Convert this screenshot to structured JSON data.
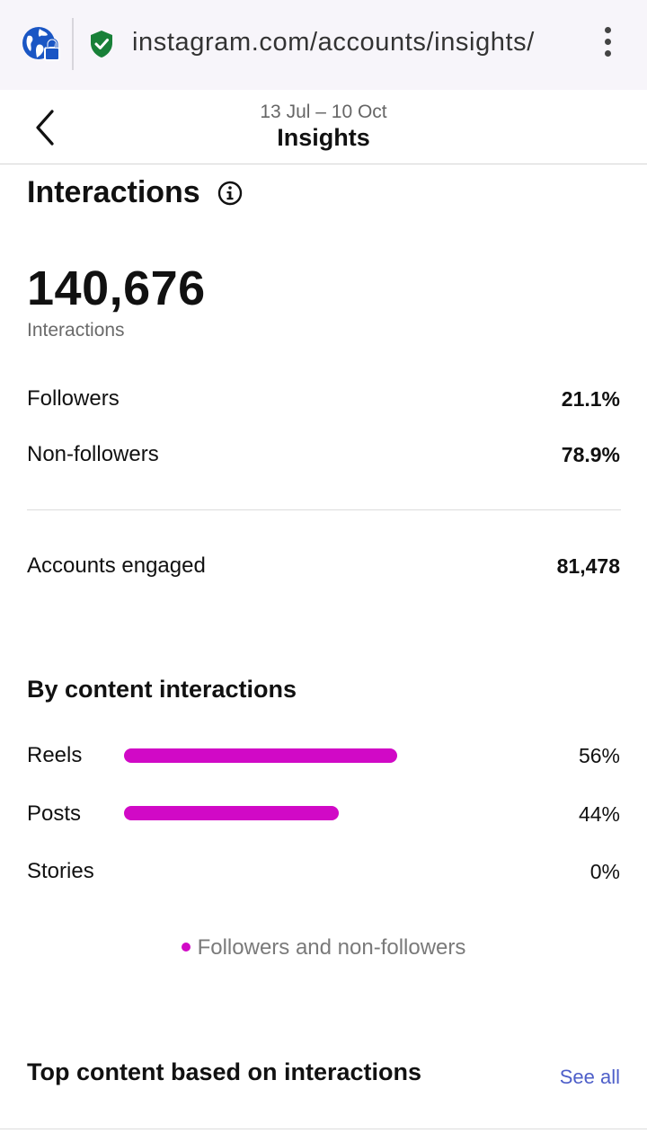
{
  "browser": {
    "url": "instagram.com/accounts/insights/",
    "icons": {
      "site": "globe-lock-icon",
      "secure": "shield-check-icon",
      "menu": "kebab-menu-icon"
    },
    "colors": {
      "secure": "#188038",
      "site": "#1a56c4"
    }
  },
  "header": {
    "date_range": "13 Jul – 10 Oct",
    "title": "Insights",
    "back_icon": "chevron-left-icon"
  },
  "interactions": {
    "title": "Interactions",
    "info_icon": "info-icon",
    "total": "140,676",
    "total_label": "Interactions",
    "breakdown": [
      {
        "label": "Followers",
        "value": "21.1%"
      },
      {
        "label": "Non-followers",
        "value": "78.9%"
      }
    ],
    "accounts_engaged": {
      "label": "Accounts engaged",
      "value": "81,478"
    }
  },
  "by_content": {
    "title": "By content interactions",
    "bar_color": "#d109c6",
    "scale_max_pct": 70,
    "items": [
      {
        "label": "Reels",
        "pct_text": "56%",
        "pct": 56
      },
      {
        "label": "Posts",
        "pct_text": "44%",
        "pct": 44
      },
      {
        "label": "Stories",
        "pct_text": "0%",
        "pct": 0
      }
    ],
    "legend": "Followers and non-followers"
  },
  "top_content": {
    "title": "Top content based on interactions",
    "see_all": "See all",
    "link_color": "#4e5fc9"
  }
}
